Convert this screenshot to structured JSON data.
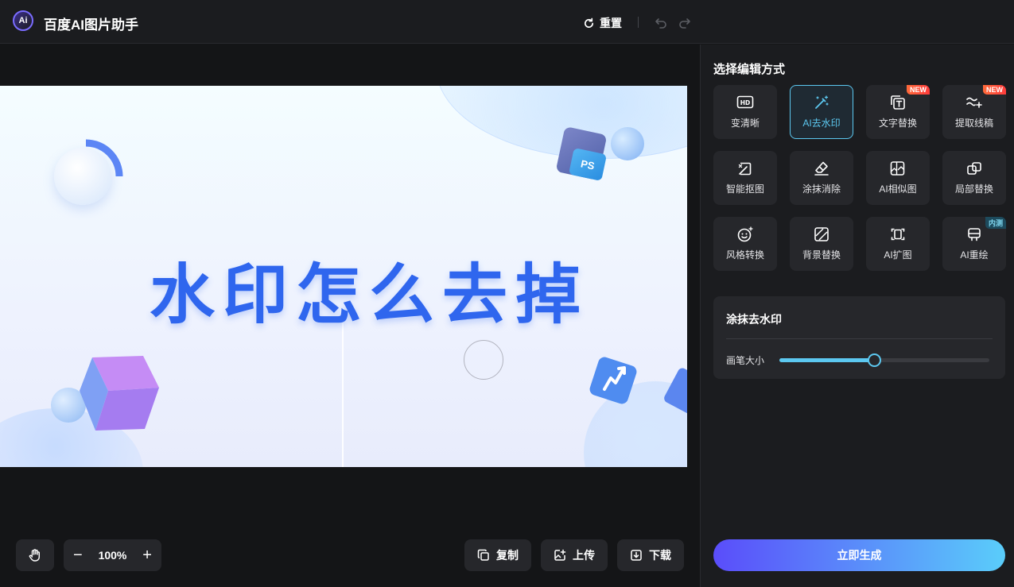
{
  "app": {
    "title": "百度AI图片助手",
    "logo_text": "Ai"
  },
  "toolbar": {
    "reset_label": "重置"
  },
  "canvas": {
    "headline": "水印怎么去掉",
    "ps_badge": "PS"
  },
  "bottom_tools": {
    "zoom_level": "100%",
    "copy_label": "复制",
    "upload_label": "上传",
    "download_label": "下载"
  },
  "panel": {
    "title": "选择编辑方式",
    "tools": [
      {
        "label": "变清晰",
        "icon": "hd-icon"
      },
      {
        "label": "AI去水印",
        "icon": "magic-wand-icon",
        "active": true
      },
      {
        "label": "文字替换",
        "icon": "text-replace-icon",
        "badge": "NEW"
      },
      {
        "label": "提取线稿",
        "icon": "line-extract-icon",
        "badge": "NEW"
      },
      {
        "label": "智能抠图",
        "icon": "smart-cutout-icon"
      },
      {
        "label": "涂抹消除",
        "icon": "eraser-icon"
      },
      {
        "label": "AI相似图",
        "icon": "similar-image-icon"
      },
      {
        "label": "局部替换",
        "icon": "partial-replace-icon"
      },
      {
        "label": "风格转换",
        "icon": "style-smile-icon"
      },
      {
        "label": "背景替换",
        "icon": "background-replace-icon"
      },
      {
        "label": "AI扩图",
        "icon": "expand-image-icon"
      },
      {
        "label": "AI重绘",
        "icon": "redraw-icon",
        "badge": "内测"
      }
    ],
    "sub_title": "涂抹去水印",
    "brush_label": "画笔大小",
    "brush_level": 0.45,
    "generate_label": "立即生成"
  },
  "colors": {
    "accent": "#5cc8f0",
    "headline": "#2f66ee",
    "new_badge": "#ff4d3a",
    "generate_start": "#5a4dfa",
    "generate_end": "#5acdfa"
  }
}
